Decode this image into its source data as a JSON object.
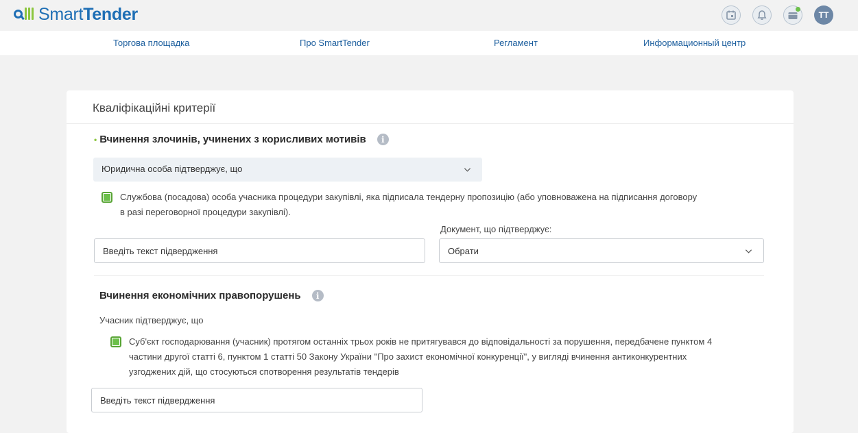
{
  "brand": {
    "name_light": "Smart",
    "name_bold": "Tender"
  },
  "header": {
    "icons": [
      "calendar-icon",
      "bell-icon",
      "wallet-icon"
    ],
    "avatar_initials": "TT"
  },
  "nav": {
    "items": [
      {
        "label": "Торгова площадка"
      },
      {
        "label": "Про SmartTender"
      },
      {
        "label": "Регламент"
      },
      {
        "label": "Информационный центр"
      }
    ]
  },
  "card": {
    "title": "Кваліфікаційні критерії",
    "section1": {
      "title": "Вчинення злочинів, учинених з корисливих мотивів",
      "required_marker": "•",
      "select_value": "Юридична особа підтверджує, що",
      "checkbox_text": "Службова (посадова) особа учасника процедури закупівлі, яка підписала тендерну пропозицію (або уповноважена на підписання договору в разі переговорної процедури закупівлі).",
      "confirm_input_placeholder": "Введіть текст підвердження",
      "document_label": "Документ, що підтверджує:",
      "document_select_value": "Обрати"
    },
    "section2": {
      "title": "Вчинення економічних правопорушень",
      "subtitle": "Учасник підтверджує, що",
      "checkbox_text": "Суб'єкт господарювання (учасник) протягом останніх трьох років не притягувався до відповідальності за порушення, передбачене пунктом 4 частини другої статті 6, пунктом 1 статті 50 Закону України \"Про захист економічної конкуренції\", у вигляді вчинення антиконкурентних узгоджених дій, що стосуються спотворення результатів тендерів",
      "confirm_input_placeholder": "Введіть текст підвердження"
    }
  },
  "colors": {
    "brand_blue": "#1f6fb5",
    "brand_green": "#8cc63f",
    "checkbox_green": "#6cc04a",
    "nav_link": "#1d5f9e"
  }
}
